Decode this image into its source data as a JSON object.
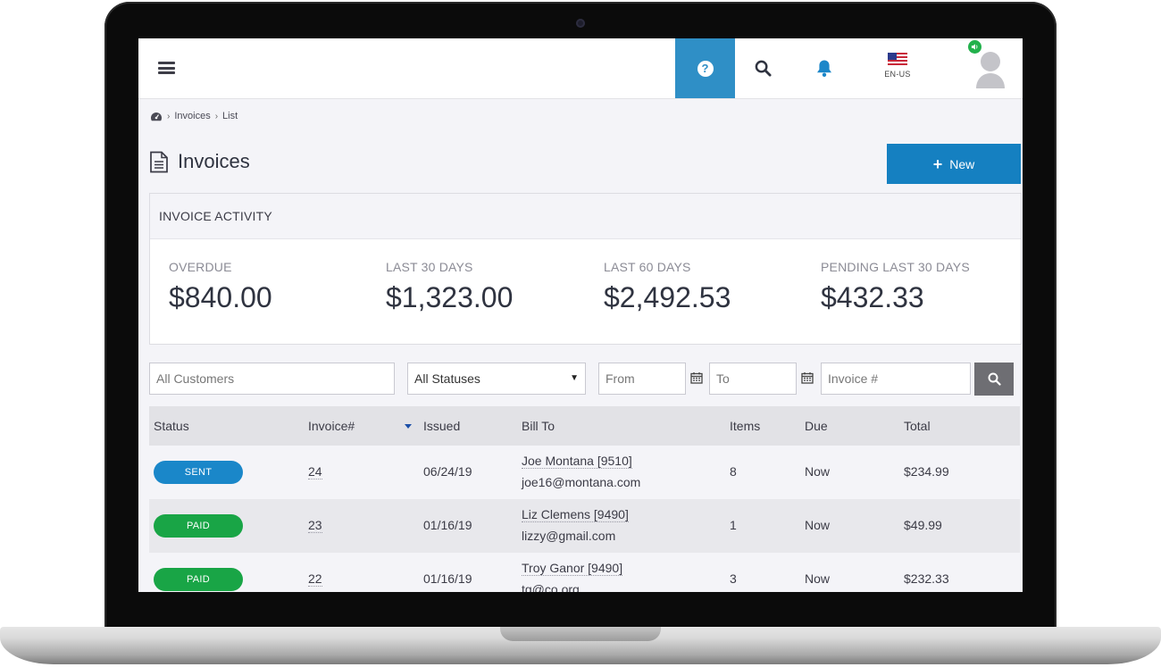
{
  "topbar": {
    "icons": [
      "menu-icon",
      "help-icon",
      "search-icon",
      "bell-icon",
      "flag-us-icon",
      "sound-icon",
      "avatar-icon"
    ],
    "language_code": "EN-US",
    "help_color": "#2f8fc6"
  },
  "breadcrumb": {
    "items": [
      "Invoices",
      "List"
    ]
  },
  "page": {
    "title": "Invoices",
    "new_button_label": "New"
  },
  "activity": {
    "heading": "INVOICE ACTIVITY",
    "stats": [
      {
        "label": "OVERDUE",
        "value": "$840.00"
      },
      {
        "label": "LAST 30 DAYS",
        "value": "$1,323.00"
      },
      {
        "label": "LAST 60 DAYS",
        "value": "$2,492.53"
      },
      {
        "label": "PENDING LAST 30 DAYS",
        "value": "$432.33"
      }
    ]
  },
  "filters": {
    "customers_placeholder": "All Customers",
    "status_selected": "All Statuses",
    "from_placeholder": "From",
    "to_placeholder": "To",
    "invoice_placeholder": "Invoice #"
  },
  "table": {
    "columns": [
      "Status",
      "Invoice#",
      "Issued",
      "Bill To",
      "Items",
      "Due",
      "Total"
    ],
    "rows": [
      {
        "status": "SENT",
        "status_color": "#1a87c9",
        "invoice": "24",
        "issued": "06/24/19",
        "bill_name": "Joe Montana [9510]",
        "bill_email": "joe16@montana.com",
        "items": "8",
        "due": "Now",
        "total": "$234.99"
      },
      {
        "status": "PAID",
        "status_color": "#19a546",
        "invoice": "23",
        "issued": "01/16/19",
        "bill_name": "Liz Clemens [9490]",
        "bill_email": "lizzy@gmail.com",
        "items": "1",
        "due": "Now",
        "total": "$49.99"
      },
      {
        "status": "PAID",
        "status_color": "#19a546",
        "invoice": "22",
        "issued": "01/16/19",
        "bill_name": "Troy Ganor [9490]",
        "bill_email": "tg@co.org",
        "items": "3",
        "due": "Now",
        "total": "$232.33"
      }
    ]
  },
  "colors": {
    "primary": "#1580c1",
    "sent": "#1a87c9",
    "paid": "#19a546"
  }
}
